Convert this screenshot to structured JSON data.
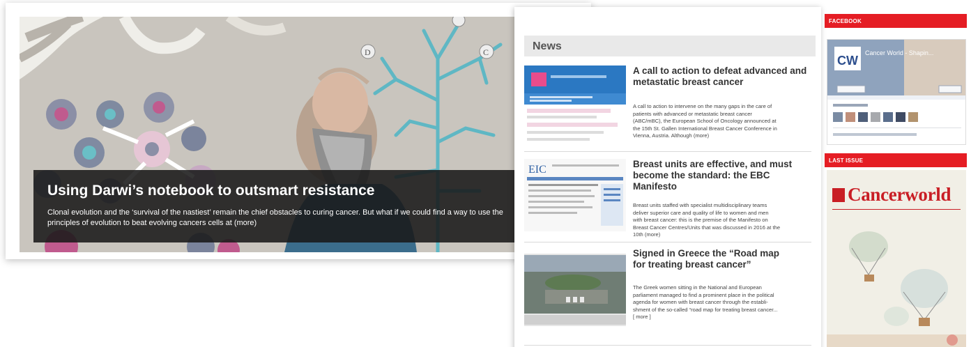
{
  "hero": {
    "title": "Using Darwi’s notebook to outsmart resistance",
    "text_line1": "Clonal evolution and the ‘survival of the nastiest’ remain the chief obstacles to curing cancer. But what if we could find a way to use the",
    "text_line2": "principles of evolution to beat evolving cancers cells at (more)"
  },
  "news": {
    "header": "News",
    "items": [
      {
        "title_line1": "A call to action to defeat advanced and",
        "title_line2": "metastatic breast cancer",
        "text": [
          "A call to action to intervene on the many gaps in the care of",
          "patients with advanced or metastatic breast cancer",
          "(ABC/mBC), the European School of Oncology announced at",
          "the 15th St. Gallen International Breast Cancer Conference in",
          "Vienna, Austria. Although (more)"
        ]
      },
      {
        "title_line1": "Breast units are effective, and must",
        "title_line2": "become the standard: the EBC Manifesto",
        "text": [
          "Breast units staffed with specialist multidisciplinary teams",
          "deliver superior care and quality of life to women and men",
          "with breast cancer: this is the premise of the Manifesto on",
          "Breast Cancer Centres/Units that was discussed in 2016 at the",
          "10th (more)"
        ]
      },
      {
        "title_line1": "Signed in Greece the “Road map",
        "title_line2": "for treating breast cancer”",
        "text": [
          "The Greek women sitting in the National and European",
          "parliament managed to find a prominent place in the political",
          "agenda for women with breast cancer through the establi-",
          "shment of the so-called “road map for treating breast cancer...",
          "[ more ]"
        ]
      }
    ]
  },
  "sidebar": {
    "facebook_label": "FACEBOOK",
    "facebook_page_name": "Cancer World - Shapin...",
    "last_issue_label": "LAST ISSUE",
    "magazine_logo": "Cancerworld"
  },
  "colors": {
    "accent_red": "#e51d24",
    "caption_bg": "#191919"
  }
}
